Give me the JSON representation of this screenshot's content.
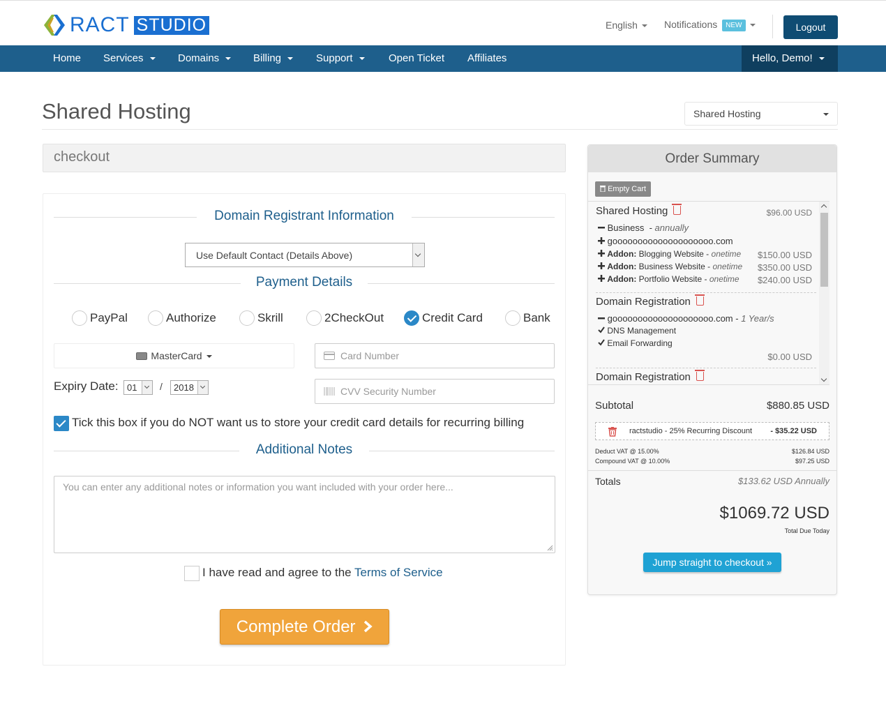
{
  "brand": {
    "name_part1": "RACT",
    "name_part2": "STUDIO"
  },
  "header": {
    "language": "English",
    "notifications": "Notifications",
    "notifications_badge": "NEW",
    "logout": "Logout"
  },
  "nav": {
    "items": [
      {
        "label": "Home",
        "dropdown": false
      },
      {
        "label": "Services",
        "dropdown": true
      },
      {
        "label": "Domains",
        "dropdown": true
      },
      {
        "label": "Billing",
        "dropdown": true
      },
      {
        "label": "Support",
        "dropdown": true
      },
      {
        "label": "Open Ticket",
        "dropdown": false
      },
      {
        "label": "Affiliates",
        "dropdown": false
      }
    ],
    "user": "Hello, Demo!"
  },
  "page": {
    "title": "Shared Hosting",
    "category_select": "Shared Hosting",
    "breadcrumb": "checkout"
  },
  "form": {
    "domain_registrant_heading": "Domain Registrant Information",
    "contact_select": "Use Default Contact (Details Above)",
    "payment_heading": "Payment Details",
    "payment_methods": [
      {
        "label": "PayPal",
        "checked": false
      },
      {
        "label": "Authorize",
        "checked": false
      },
      {
        "label": "Skrill",
        "checked": false
      },
      {
        "label": "2CheckOut",
        "checked": false
      },
      {
        "label": "Credit Card",
        "checked": true
      },
      {
        "label": "Bank",
        "checked": false
      }
    ],
    "card_type": "MasterCard",
    "card_number_placeholder": "Card Number",
    "cvv_placeholder": "CVV Security Number",
    "expiry_label": "Expiry Date:",
    "expiry_month": "01",
    "expiry_separator": "/",
    "expiry_year": "2018",
    "store_card_label": "Tick this box if you do NOT want us to store your credit card details for recurring billing",
    "store_card_checked": true,
    "notes_heading": "Additional Notes",
    "notes_placeholder": "You can enter any additional notes or information you want included with your order here...",
    "tos_prefix": "I have read and agree to the ",
    "tos_link": "Terms of Service",
    "complete_button": "Complete Order"
  },
  "summary": {
    "heading": "Order Summary",
    "empty_cart": "Empty Cart",
    "items": [
      {
        "title": "Shared Hosting",
        "price": "$96.00 USD",
        "plan": "Business",
        "cycle": "annually",
        "domain": "goooooooooooooooooooo.com",
        "addon_label": "Addon:",
        "addons": [
          {
            "name": "Blogging Website",
            "cycle": "onetime",
            "price": "$150.00 USD"
          },
          {
            "name": "Business Website",
            "cycle": "onetime",
            "price": "$350.00 USD"
          },
          {
            "name": "Portfolio Website",
            "cycle": "onetime",
            "price": "$240.00 USD"
          }
        ]
      },
      {
        "title": "Domain Registration",
        "domain": "goooooooooooooooooooo.com",
        "period": "1 Year/s",
        "features": [
          "DNS Management",
          "Email Forwarding"
        ],
        "price": "$0.00 USD"
      },
      {
        "title": "Domain Registration"
      }
    ],
    "subtotal_label": "Subtotal",
    "subtotal": "$880.85 USD",
    "discount_label": "ractstudio - 25% Recurring Discount",
    "discount_value": "- $35.22 USD",
    "vat1_label": "Deduct VAT @ 15.00%",
    "vat1_value": "$126.84 USD",
    "vat2_label": "Compound VAT @ 10.00%",
    "vat2_value": "$97.25 USD",
    "totals_label": "Totals",
    "recurring": "$133.62 USD Annually",
    "total_due": "$1069.72 USD",
    "total_due_label": "Total Due Today",
    "jump_button": "Jump straight to checkout »"
  },
  "colors": {
    "nav_bg": "#1e5f8c",
    "brand_blue": "#1a6fd1",
    "accent_orange": "#f0a43b",
    "check_blue": "#2b88c7",
    "jump_blue": "#1fa2d4",
    "trash_red": "#d9534f"
  }
}
